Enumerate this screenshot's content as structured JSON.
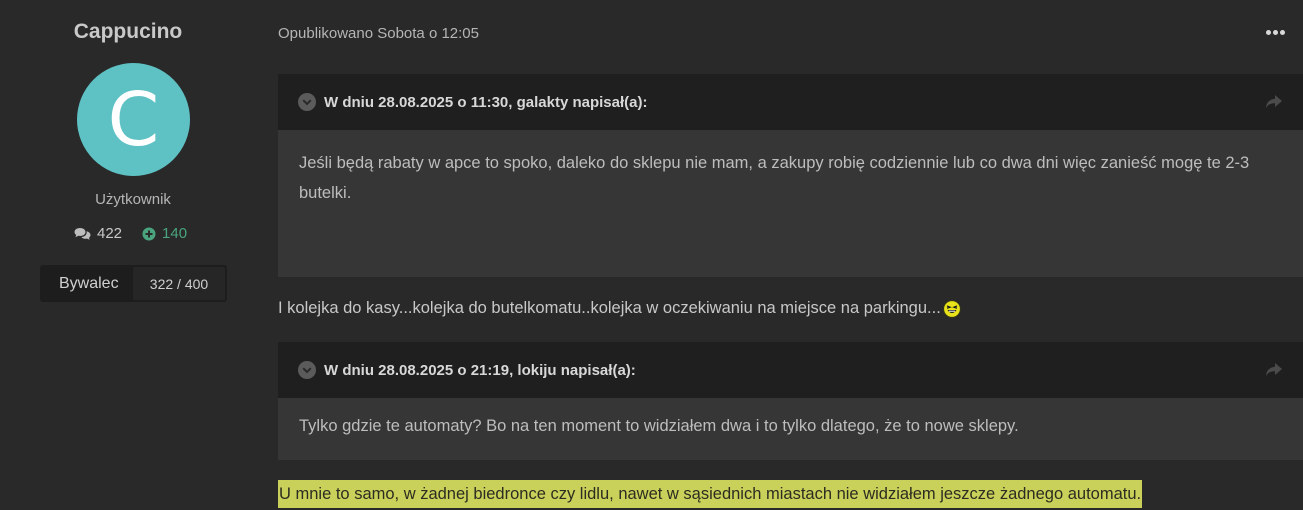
{
  "author": {
    "name": "Cappucino",
    "avatar_letter": "C",
    "avatar_color": "#5ec1c4",
    "group": "Użytkownik",
    "posts_count": "422",
    "reputation": "140",
    "rank_label": "Bywalec",
    "rank_progress": "322 / 400"
  },
  "post": {
    "meta": "Opublikowano Sobota o 12:05",
    "more_icon": "ellipsis-icon",
    "quotes": [
      {
        "title": "W dniu 28.08.2025 o 11:30, galakty napisał(a):",
        "body": "Jeśli będą rabaty w apce to spoko, daleko do sklepu nie mam, a zakupy robię codziennie lub co dwa dni więc zanieść mogę te 2-3 butelki."
      },
      {
        "title": "W dniu 28.08.2025 o 21:19, lokiju napisał(a):",
        "body": "Tylko gdzie te automaty? Bo na ten moment to widziałem dwa i to tylko dlatego, że to nowe sklepy."
      }
    ],
    "reply1": "I kolejka do kasy...kolejka do butelkomatu..kolejka w oczekiwaniu na miejsce na parkingu...",
    "reply2_highlighted": "U mnie to samo, w żadnej biedronce czy lidlu, nawet w sąsiednich miastach nie widziałem jeszcze żadnego automatu.",
    "highlight_color": "#c9d15a",
    "reputation_color": "#4aa57f"
  }
}
